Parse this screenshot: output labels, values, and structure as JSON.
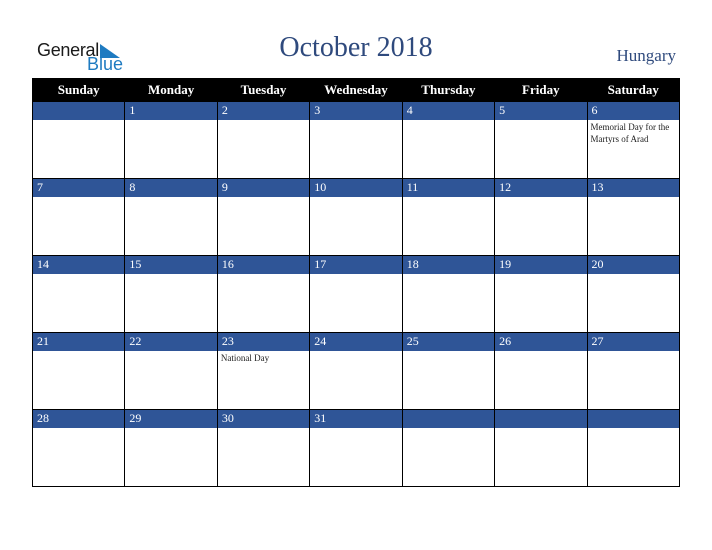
{
  "logo": {
    "text1": "General",
    "text2": "Blue"
  },
  "header": {
    "title": "October 2018",
    "country": "Hungary"
  },
  "colors": {
    "accent": "#2f5597",
    "header_bg": "#000000",
    "title": "#2f4a7d",
    "logo_blue": "#1f7bc1"
  },
  "days": [
    "Sunday",
    "Monday",
    "Tuesday",
    "Wednesday",
    "Thursday",
    "Friday",
    "Saturday"
  ],
  "weeks": [
    [
      {
        "d": "",
        "e": ""
      },
      {
        "d": "1",
        "e": ""
      },
      {
        "d": "2",
        "e": ""
      },
      {
        "d": "3",
        "e": ""
      },
      {
        "d": "4",
        "e": ""
      },
      {
        "d": "5",
        "e": ""
      },
      {
        "d": "6",
        "e": "Memorial Day for the Martyrs of Arad"
      }
    ],
    [
      {
        "d": "7",
        "e": ""
      },
      {
        "d": "8",
        "e": ""
      },
      {
        "d": "9",
        "e": ""
      },
      {
        "d": "10",
        "e": ""
      },
      {
        "d": "11",
        "e": ""
      },
      {
        "d": "12",
        "e": ""
      },
      {
        "d": "13",
        "e": ""
      }
    ],
    [
      {
        "d": "14",
        "e": ""
      },
      {
        "d": "15",
        "e": ""
      },
      {
        "d": "16",
        "e": ""
      },
      {
        "d": "17",
        "e": ""
      },
      {
        "d": "18",
        "e": ""
      },
      {
        "d": "19",
        "e": ""
      },
      {
        "d": "20",
        "e": ""
      }
    ],
    [
      {
        "d": "21",
        "e": ""
      },
      {
        "d": "22",
        "e": ""
      },
      {
        "d": "23",
        "e": "National Day"
      },
      {
        "d": "24",
        "e": ""
      },
      {
        "d": "25",
        "e": ""
      },
      {
        "d": "26",
        "e": ""
      },
      {
        "d": "27",
        "e": ""
      }
    ],
    [
      {
        "d": "28",
        "e": ""
      },
      {
        "d": "29",
        "e": ""
      },
      {
        "d": "30",
        "e": ""
      },
      {
        "d": "31",
        "e": ""
      },
      {
        "d": "",
        "e": ""
      },
      {
        "d": "",
        "e": ""
      },
      {
        "d": "",
        "e": ""
      }
    ]
  ]
}
